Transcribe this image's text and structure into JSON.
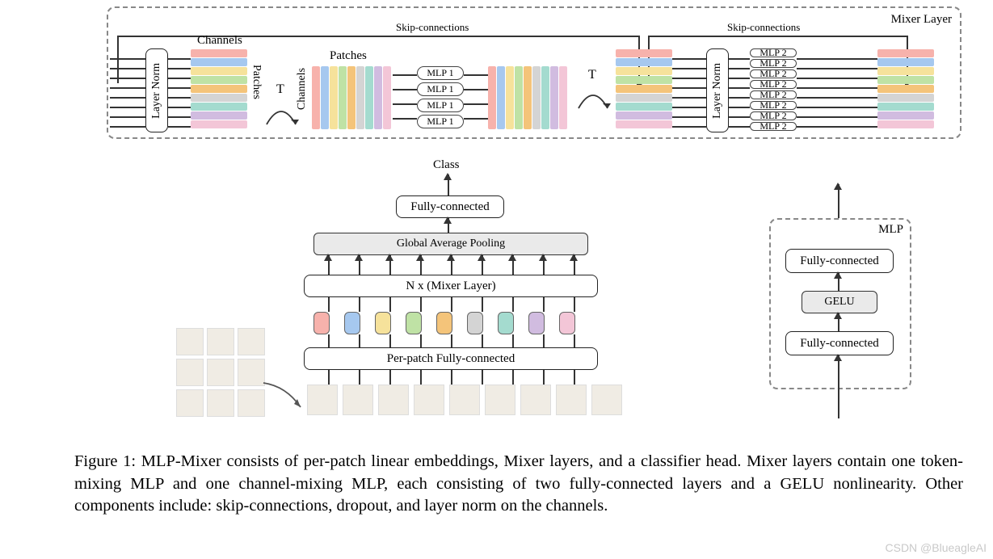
{
  "mixer_layer": {
    "title": "Mixer Layer",
    "skip1": "Skip-connections",
    "skip2": "Skip-connections",
    "channels_label": "Channels",
    "patches_label_v": "Patches",
    "patches_label_h": "Patches",
    "channels_label_v": "Channels",
    "layer_norm1": "Layer Norm",
    "layer_norm2": "Layer Norm",
    "transpose": "T",
    "mlp1": "MLP 1",
    "mlp2": "MLP 2",
    "colors": [
      "#f7b2ac",
      "#a6c8ef",
      "#f6e29b",
      "#bfe2a5",
      "#f4c47a",
      "#d4d4d4",
      "#a4dbcf",
      "#d1bce0",
      "#f3c6d7"
    ]
  },
  "pipeline": {
    "class_label": "Class",
    "fully_connected": "Fully-connected",
    "global_avg_pool": "Global Average Pooling",
    "n_mixer": "N x (Mixer Layer)",
    "per_patch_fc": "Per-patch Fully-connected"
  },
  "mlp_block": {
    "title": "MLP",
    "fc1": "Fully-connected",
    "gelu": "GELU",
    "fc2": "Fully-connected"
  },
  "caption": "Figure 1: MLP-Mixer consists of per-patch linear embeddings, Mixer layers, and a classifier head. Mixer layers contain one token-mixing MLP and one channel-mixing MLP, each consisting of two fully-connected layers and a GELU nonlinearity. Other components include: skip-connections, dropout, and layer norm on the channels.",
  "watermark": "CSDN @BlueagleAI"
}
